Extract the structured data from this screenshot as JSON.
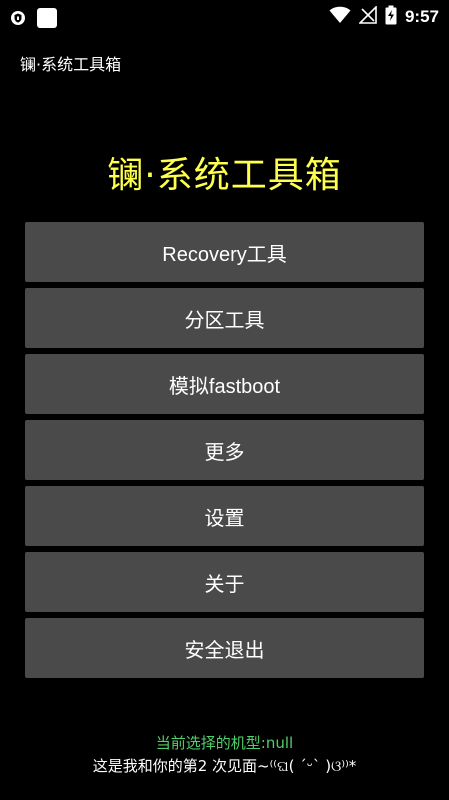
{
  "status_bar": {
    "time": "9:57",
    "icons": [
      "shield-icon",
      "app-square-icon",
      "wifi-icon",
      "signal-icon",
      "battery-charging-icon"
    ]
  },
  "app": {
    "title": "镧·系统工具箱"
  },
  "main": {
    "heading": "镧·系统工具箱",
    "buttons": [
      {
        "label": "Recovery工具"
      },
      {
        "label": "分区工具"
      },
      {
        "label": "模拟fastboot"
      },
      {
        "label": "更多"
      },
      {
        "label": "设置"
      },
      {
        "label": "关于"
      },
      {
        "label": "安全退出"
      }
    ]
  },
  "footer": {
    "model_text": "当前选择的机型:null",
    "greeting_text": "这是我和你的第2 次见面~⁽⁽ଘ( ˊᵕˋ )ଓ⁾⁾*"
  },
  "colors": {
    "background": "#000000",
    "heading": "#ffff4d",
    "button_bg": "#4a4a4a",
    "model_text": "#4fd06a"
  }
}
